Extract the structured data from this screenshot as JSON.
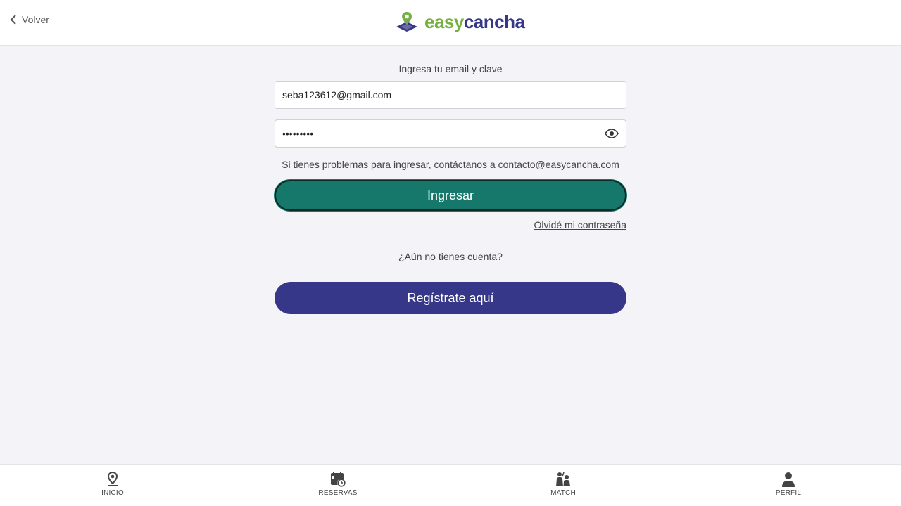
{
  "header": {
    "back_label": "Volver",
    "logo": {
      "part1": "easy",
      "part2": "cancha"
    }
  },
  "login": {
    "prompt": "Ingresa tu email y clave",
    "email_value": "seba123612@gmail.com",
    "password_value": "•••••••••",
    "help_text": "Si tienes problemas para ingresar, contáctanos a contacto@easycancha.com",
    "submit_label": "Ingresar",
    "forgot_label": "Olvidé mi contraseña",
    "no_account_text": "¿Aún no tienes cuenta?",
    "register_label": "Regístrate aquí"
  },
  "nav": {
    "items": [
      {
        "label": "INICIO",
        "icon": "location-pin-icon"
      },
      {
        "label": "RESERVAS",
        "icon": "calendar-clock-icon"
      },
      {
        "label": "MATCH",
        "icon": "players-icon"
      },
      {
        "label": "PERFIL",
        "icon": "person-icon"
      }
    ]
  },
  "colors": {
    "brand_green": "#76b043",
    "brand_purple": "#37378a",
    "button_teal": "#16786a",
    "background": "#f4f4f8"
  }
}
